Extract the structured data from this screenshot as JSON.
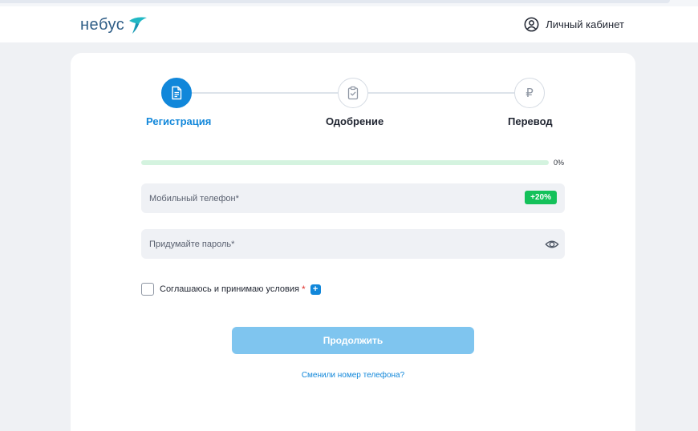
{
  "header": {
    "logo_text": "небус",
    "account_label": "Личный кабинет"
  },
  "steps": [
    {
      "label": "Регистрация",
      "icon": "document-icon",
      "active": true
    },
    {
      "label": "Одобрение",
      "icon": "clipboard-check-icon",
      "active": false
    },
    {
      "label": "Перевод",
      "icon": "ruble-icon",
      "active": false
    }
  ],
  "ruble_symbol": "₽",
  "progress": {
    "value": 0,
    "text": "0%"
  },
  "form": {
    "phone_placeholder": "Мобильный телефон*",
    "phone_bonus": "+20%",
    "password_placeholder": "Придумайте пароль*",
    "agree_label": "Соглашаюсь и принимаю условия",
    "required_mark": "*",
    "expand_symbol": "+",
    "continue_label": "Продолжить",
    "changed_phone_link": "Сменили номер телефона?"
  },
  "colors": {
    "accent": "#1187da",
    "button_disabled": "#7fc5ef",
    "success": "#14c15a",
    "progress_track": "#d4f3df",
    "required": "#e0332e"
  }
}
